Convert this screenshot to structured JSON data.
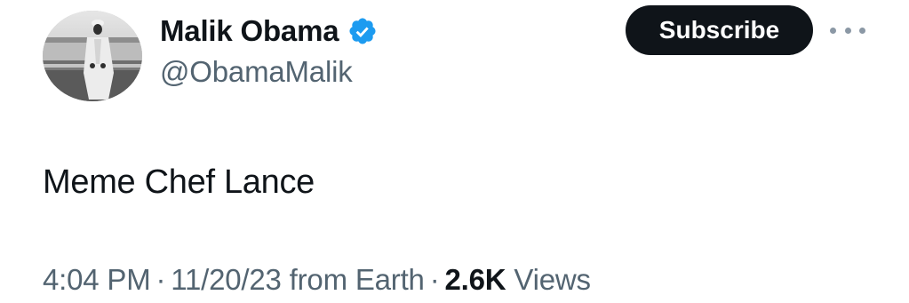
{
  "author": {
    "display_name": "Malik Obama",
    "handle": "@ObamaMalik",
    "verified_icon": "verified-badge-icon",
    "avatar_icon": "profile-photo"
  },
  "actions": {
    "subscribe_label": "Subscribe",
    "more_icon": "more-options-icon"
  },
  "tweet": {
    "text": "Meme Chef Lance"
  },
  "meta": {
    "time": "4:04 PM",
    "separator": "·",
    "date": "11/20/23",
    "source": "from Earth",
    "views_count": "2.6K",
    "views_label": "Views"
  },
  "colors": {
    "primary_text": "#0f1419",
    "secondary_text": "#536471",
    "verified_blue": "#1d9bf0",
    "button_bg": "#0f1419"
  }
}
